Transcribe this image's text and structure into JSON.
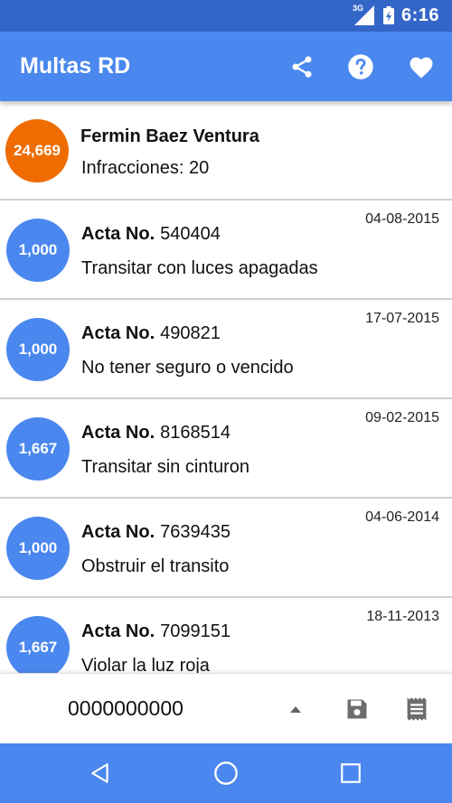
{
  "status_bar": {
    "network": "3G",
    "time": "6:16"
  },
  "app_bar": {
    "title": "Multas RD",
    "actions": [
      {
        "icon": "share-icon"
      },
      {
        "icon": "help-icon"
      },
      {
        "icon": "heart-icon"
      }
    ]
  },
  "owner": {
    "total": "24,669",
    "name": "Fermin Baez Ventura",
    "infractions": "Infracciones: 20"
  },
  "fines": [
    {
      "amount": "1,000",
      "acta_label": "Acta No.",
      "acta_number": "540404",
      "description": "Transitar con luces apagadas",
      "date": "04-08-2015"
    },
    {
      "amount": "1,000",
      "acta_label": "Acta No.",
      "acta_number": "490821",
      "description": "No tener seguro o vencido",
      "date": "17-07-2015"
    },
    {
      "amount": "1,667",
      "acta_label": "Acta No.",
      "acta_number": "8168514",
      "description": "Transitar sin cinturon",
      "date": "09-02-2015"
    },
    {
      "amount": "1,000",
      "acta_label": "Acta No.",
      "acta_number": "7639435",
      "description": "Obstruir el transito",
      "date": "04-06-2014"
    },
    {
      "amount": "1,667",
      "acta_label": "Acta No.",
      "acta_number": "7099151",
      "description": "Violar la luz roja",
      "date": "18-11-2013"
    }
  ],
  "bottom_bar": {
    "id_value": "0000000000"
  },
  "colors": {
    "primary": "#4a87ee",
    "status_bar": "#3466c8",
    "owner_badge": "#ef6c00"
  }
}
